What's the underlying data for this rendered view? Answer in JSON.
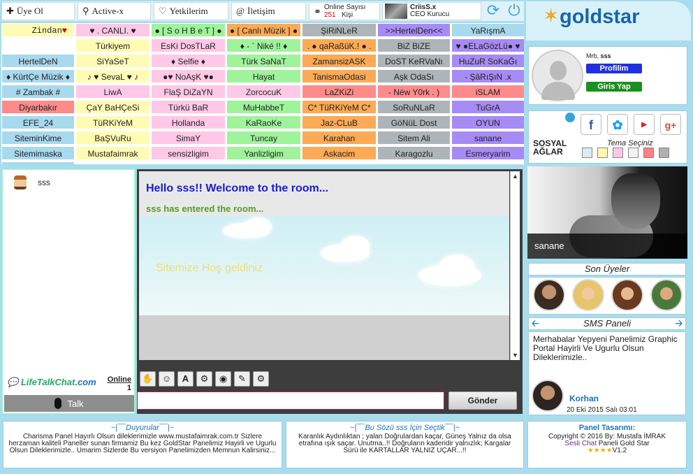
{
  "topbar": {
    "uye_ol": "Üye Ol",
    "active": "Active-x",
    "yetkilerim": "Yetkilerim",
    "iletisim": "İletişim",
    "online_label": "Online Sayısı",
    "online_count": "251",
    "online_unit": "Kişi",
    "ceo_name": "CriisS.x",
    "ceo_title": "CEO Kurucu"
  },
  "rooms": [
    {
      "label": "Zindan",
      "color": "c-yel"
    },
    {
      "label": "♥ . CANLI. ♥",
      "color": "c-pink"
    },
    {
      "label": "● [ S o H B e T ] ●",
      "color": "c-grn"
    },
    {
      "label": "● [ Canlı Müzik ] ●",
      "color": "c-orn"
    },
    {
      "label": "ŞiRiNLeR",
      "color": "c-gry"
    },
    {
      "label": ">>HertelDen<<",
      "color": "c-pur"
    },
    {
      "label": "YaRışmA",
      "color": "c-blue"
    },
    {
      "label": "",
      "color": "c-white"
    },
    {
      "label": "Türkiyem",
      "color": "c-yel"
    },
    {
      "label": "EsKi DosTLaR",
      "color": "c-pink"
    },
    {
      "label": "♦ - ` Niké !! ♦",
      "color": "c-grn"
    },
    {
      "label": ". ● qaRaßüK.! ● .",
      "color": "c-orn"
    },
    {
      "label": "BiZ BiZE",
      "color": "c-gry"
    },
    {
      "label": "♥ ●ELaGözLü● ♥",
      "color": "c-pur"
    },
    {
      "label": "HertelDeN",
      "color": "c-blue"
    },
    {
      "label": "SiYaSeT",
      "color": "c-yel"
    },
    {
      "label": "♦ Selfie ♦",
      "color": "c-pink"
    },
    {
      "label": "Türk SaNaT",
      "color": "c-grn"
    },
    {
      "label": "ZamansizASK",
      "color": "c-orn"
    },
    {
      "label": "DoST KeRVaNı",
      "color": "c-gry"
    },
    {
      "label": "HuZuR SoKaĞı",
      "color": "c-pur"
    },
    {
      "label": "♦ KürtÇe Müzik ♦",
      "color": "c-blue"
    },
    {
      "label": "♪ ♥ SevaL ♥ ♪",
      "color": "c-yel"
    },
    {
      "label": "●♥ NoAşK ♥●",
      "color": "c-pink"
    },
    {
      "label": "Hayat",
      "color": "c-grn"
    },
    {
      "label": "TanismaOdasi",
      "color": "c-orn"
    },
    {
      "label": "Aşk OdaSı",
      "color": "c-gry"
    },
    {
      "label": "- ŞâRıŞıN .x",
      "color": "c-pur"
    },
    {
      "label": "# Zambak #",
      "color": "c-blue"
    },
    {
      "label": "LiwA",
      "color": "c-pink"
    },
    {
      "label": "FlaŞ DiZaYN",
      "color": "c-pink"
    },
    {
      "label": "ZorcocuK",
      "color": "c-pink"
    },
    {
      "label": "LaZKiZi",
      "color": "c-red"
    },
    {
      "label": "- Néw Y0rk . )",
      "color": "c-red"
    },
    {
      "label": "iSLAM",
      "color": "c-red"
    },
    {
      "label": "Diyarbakır",
      "color": "c-red"
    },
    {
      "label": "ÇaY BaHÇeSi",
      "color": "c-yel"
    },
    {
      "label": "Türkü BaR",
      "color": "c-pink"
    },
    {
      "label": "MuHabbeT",
      "color": "c-grn"
    },
    {
      "label": "C* TüRKiYeM C*",
      "color": "c-orn"
    },
    {
      "label": "SoRuNLaR",
      "color": "c-gry"
    },
    {
      "label": "TuGrA",
      "color": "c-pur"
    },
    {
      "label": "EFE_24",
      "color": "c-blue"
    },
    {
      "label": "TüRKiYeM",
      "color": "c-yel"
    },
    {
      "label": "Hollanda",
      "color": "c-pink"
    },
    {
      "label": "KaRaoKe",
      "color": "c-grn"
    },
    {
      "label": "Jaz-CLuB",
      "color": "c-orn"
    },
    {
      "label": "GöNüL Dost",
      "color": "c-gry"
    },
    {
      "label": "OYUN",
      "color": "c-pur"
    },
    {
      "label": "SiteminKime",
      "color": "c-blue"
    },
    {
      "label": "BaŞVuRu",
      "color": "c-yel"
    },
    {
      "label": "SimaY",
      "color": "c-pink"
    },
    {
      "label": "Tuncay",
      "color": "c-grn"
    },
    {
      "label": "Karahan",
      "color": "c-orn"
    },
    {
      "label": "Sitem Ali",
      "color": "c-gry"
    },
    {
      "label": "sanane",
      "color": "c-pur"
    },
    {
      "label": "Sitemimaska",
      "color": "c-blue"
    },
    {
      "label": "Mustafaimrak",
      "color": "c-yel"
    },
    {
      "label": "sensizligim",
      "color": "c-pink"
    },
    {
      "label": "Yanlizligim",
      "color": "c-grn"
    },
    {
      "label": "Askacim",
      "color": "c-orn"
    },
    {
      "label": "Karagozlu",
      "color": "c-gry"
    },
    {
      "label": "Esmeryarim",
      "color": "c-pur"
    }
  ],
  "userlist": {
    "user": "sss",
    "brand": "LifeTalkChat",
    "brand_domain": ".com",
    "online_label": "Online",
    "online_count": "1",
    "talk_label": "Talk"
  },
  "chat": {
    "welcome": "Hello sss!! Welcome to the room...",
    "entered": "sss has entered the room...",
    "sitemize": "Sitemize Hoş geldiniz",
    "send_label": "Gönder",
    "message_value": ""
  },
  "right": {
    "logo": "goldstar",
    "member_prefix": "Mrb,",
    "member_name": "sss",
    "profile_btn": "Profilim",
    "login_btn": "Giris Yap",
    "social_line1": "SOSYAL",
    "social_line2": "AĞLAR",
    "tema": "Tema Seçiniz",
    "photo_caption": "sanane",
    "son_title": "Son Üyeler",
    "sms_title": "SMS Paneli",
    "sms_text": "Merhabalar Yepyeni Panelimiz Graphic Portal Hayirli Ve Ugurlu Olsun Dileklerimizle..",
    "sms_name": "Korhan",
    "sms_date": "20 Eki 2015 Salı 03:01",
    "theme_colors": [
      "#d9ecf4",
      "#fff9b0",
      "#ffc8e6",
      "#f2f2f2",
      "#ff8080",
      "#b0b0b0"
    ],
    "social_colors": {
      "facebook": "#3b5998",
      "twitter": "#1da1f2",
      "youtube": "#e62117",
      "gplus": "#dd4b39"
    }
  },
  "footer": {
    "f1_title": "~|¯¯Duyurular¯¯|~",
    "f1_text": "Charisma Panel Hayırlı Olsun dileklerimizle www.mustafaimrak.com.tr Sizlere herzaman kaliteli Paneller sunan firmamiz Bu kez GoldStar Panelimiz Hayirli ve Ugurlu Olsun Dileklerimizle.. Umarim Sizlerde Bu versiyon Panelimizden Memnun Kalirsiniz...",
    "f2_title": "~|¯¯Bu Sözü sss İçin Seçtik¯¯|~",
    "f2_text": "Karanlık Aydınlıktan ; yalan Doğrulardan kaçar, Güneş Yalnız da olsa etrafına ışık saçar. Unutma..!! Doğruların kaderidir yalnızlık; Kargalar Sürü ile KARTALLAR YALNIZ UÇAR...!!",
    "f3_title": "Panel Tasarımı:",
    "f3_copy": "Copyright © 2016 By: Mustafa İMRAK",
    "f3_sesli": "Sesli Chat",
    "f3_panel": " Paneli Gold Star",
    "f3_stars": "★★★★",
    "f3_ver": "V1.2"
  }
}
